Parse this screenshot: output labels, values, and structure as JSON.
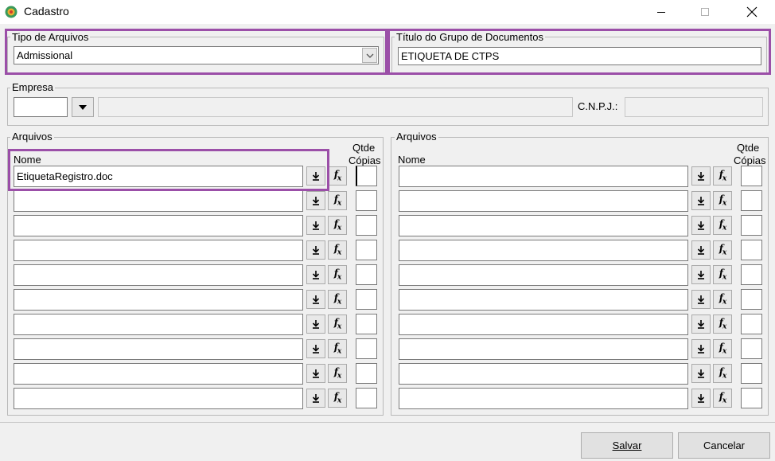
{
  "window": {
    "title": "Cadastro"
  },
  "tipo_arquivos": {
    "group_label": "Tipo de Arquivos",
    "value": "Admissional"
  },
  "titulo_grupo": {
    "group_label": "Título do Grupo de Documentos",
    "value": "ETIQUETA DE CTPS"
  },
  "empresa": {
    "group_label": "Empresa",
    "code": "",
    "name": "",
    "cnpj_label": "C.N.P.J.:",
    "cnpj": ""
  },
  "arquivos_left": {
    "group_label": "Arquivos",
    "nome_label": "Nome",
    "qtde_label": "Qtde",
    "copias_label": "Cópias",
    "rows": [
      {
        "nome": "EtiquetaRegistro.doc",
        "qtde": ""
      },
      {
        "nome": "",
        "qtde": ""
      },
      {
        "nome": "",
        "qtde": ""
      },
      {
        "nome": "",
        "qtde": ""
      },
      {
        "nome": "",
        "qtde": ""
      },
      {
        "nome": "",
        "qtde": ""
      },
      {
        "nome": "",
        "qtde": ""
      },
      {
        "nome": "",
        "qtde": ""
      },
      {
        "nome": "",
        "qtde": ""
      },
      {
        "nome": "",
        "qtde": ""
      }
    ]
  },
  "arquivos_right": {
    "group_label": "Arquivos",
    "nome_label": "Nome",
    "qtde_label": "Qtde",
    "copias_label": "Cópias",
    "rows": [
      {
        "nome": "",
        "qtde": ""
      },
      {
        "nome": "",
        "qtde": ""
      },
      {
        "nome": "",
        "qtde": ""
      },
      {
        "nome": "",
        "qtde": ""
      },
      {
        "nome": "",
        "qtde": ""
      },
      {
        "nome": "",
        "qtde": ""
      },
      {
        "nome": "",
        "qtde": ""
      },
      {
        "nome": "",
        "qtde": ""
      },
      {
        "nome": "",
        "qtde": ""
      },
      {
        "nome": "",
        "qtde": ""
      }
    ]
  },
  "buttons": {
    "save": "Salvar",
    "cancel": "Cancelar"
  },
  "icons": {
    "download": "download-icon",
    "function": "fx-function-icon"
  },
  "colors": {
    "highlight": "#9b4fa8"
  }
}
